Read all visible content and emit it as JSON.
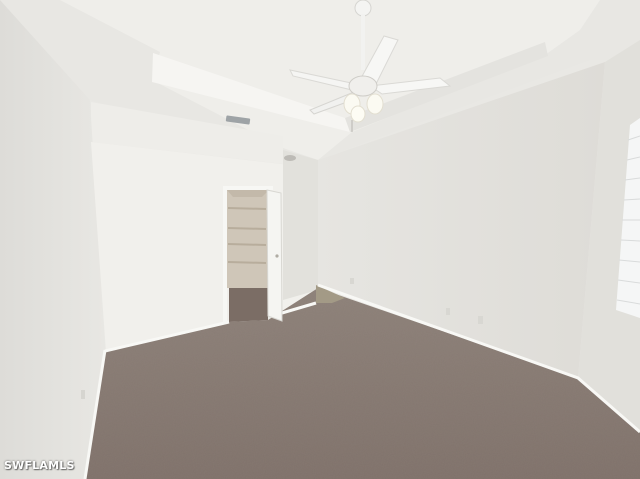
{
  "watermark": {
    "text": "SWFLAMLS"
  },
  "colors": {
    "ceiling": "#ecebe7",
    "tray": "#f3f2ee",
    "wall_light": "#eeede9",
    "wall_shadow": "#dcdbd6",
    "carpet": "#8f8178",
    "baseboard": "#f7f7f4",
    "closet_shelf": "#d6cfc3"
  },
  "icons": [
    "ceiling-fan-icon",
    "air-vent-icon",
    "smoke-detector-icon",
    "outlet-icon"
  ]
}
